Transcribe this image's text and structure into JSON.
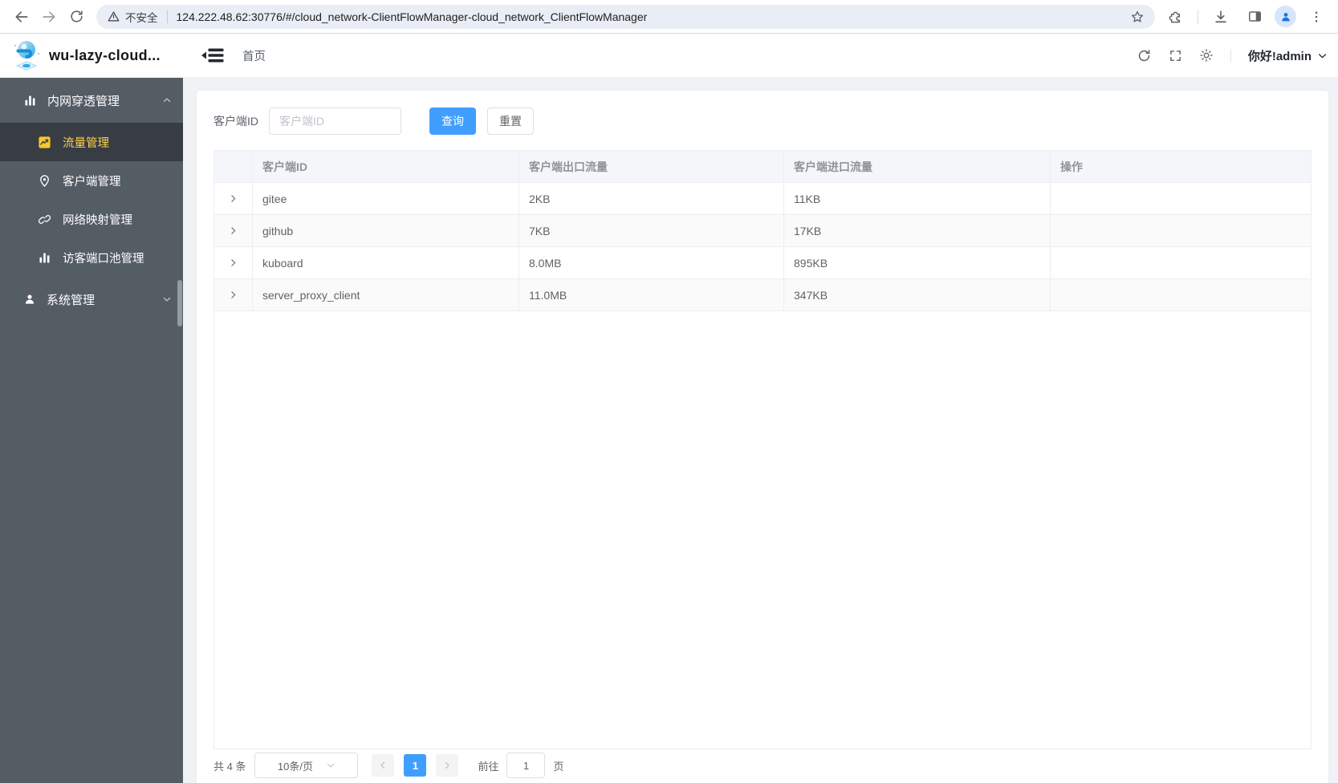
{
  "browser": {
    "security_label": "不安全",
    "url": "124.222.48.62:30776/#/cloud_network-ClientFlowManager-cloud_network_ClientFlowManager"
  },
  "header": {
    "app_title": "wu-lazy-cloud...",
    "breadcrumb": "首页",
    "greeting": "你好!admin"
  },
  "sidebar": {
    "groups": [
      {
        "label": "内网穿透管理",
        "icon": "bar-chart-icon",
        "state": "expanded",
        "items": [
          {
            "label": "流量管理",
            "icon": "trend-chart-icon",
            "active": true
          },
          {
            "label": "客户端管理",
            "icon": "location-pin-icon",
            "active": false
          },
          {
            "label": "网络映射管理",
            "icon": "link-icon",
            "active": false
          },
          {
            "label": "访客端口池管理",
            "icon": "bar-chart-icon",
            "active": false
          }
        ]
      },
      {
        "label": "系统管理",
        "icon": "user-icon",
        "state": "collapsed",
        "items": []
      }
    ]
  },
  "filters": {
    "client_id_label": "客户端ID",
    "client_id_placeholder": "客户端ID",
    "client_id_value": "",
    "query_label": "查询",
    "reset_label": "重置"
  },
  "table": {
    "columns": [
      "客户端ID",
      "客户端出口流量",
      "客户端进口流量",
      "操作"
    ],
    "rows": [
      {
        "client_id": "gitee",
        "out": "2KB",
        "in": "11KB"
      },
      {
        "client_id": "github",
        "out": "7KB",
        "in": "17KB"
      },
      {
        "client_id": "kuboard",
        "out": "8.0MB",
        "in": "895KB"
      },
      {
        "client_id": "server_proxy_client",
        "out": "11.0MB",
        "in": "347KB"
      }
    ]
  },
  "pagination": {
    "total_label": "共 4 条",
    "page_size": "10条/页",
    "current_page": "1",
    "goto_label": "前往",
    "goto_value": "1",
    "page_unit": "页"
  },
  "colors": {
    "accent": "#409eff",
    "sidebar_bg": "#545c64",
    "sidebar_active_bg": "#373d43",
    "sidebar_active_text": "#ffd04b",
    "table_header_bg": "#f4f6f9",
    "table_border": "#ebeef5"
  }
}
